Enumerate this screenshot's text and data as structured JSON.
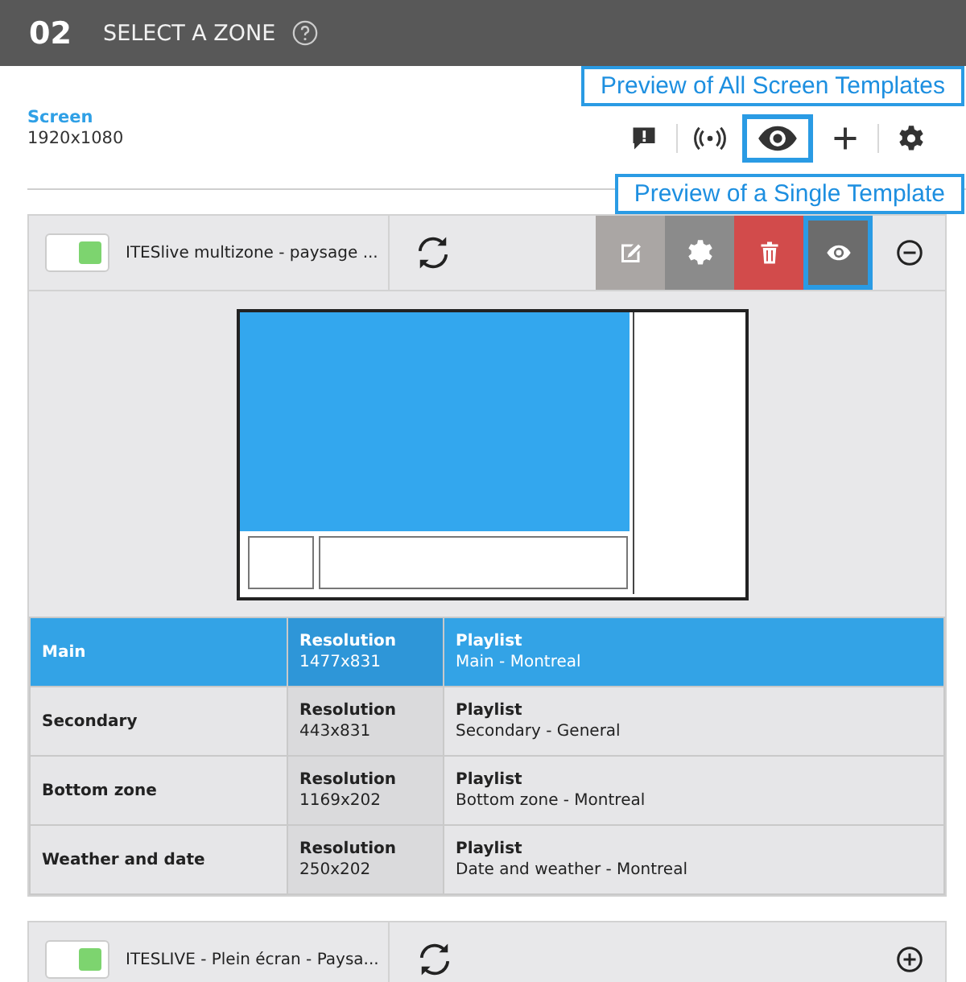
{
  "header": {
    "step": "02",
    "title": "SELECT A ZONE"
  },
  "screen": {
    "label": "Screen",
    "resolution": "1920x1080",
    "toolbar": [
      {
        "kind": "alert",
        "highlighted": false
      },
      {
        "kind": "broadcast",
        "highlighted": false
      },
      {
        "kind": "preview",
        "highlighted": true
      },
      {
        "kind": "add",
        "highlighted": false
      },
      {
        "kind": "settings",
        "highlighted": false
      }
    ]
  },
  "callouts": [
    {
      "text": "Preview of All Screen Templates"
    },
    {
      "text": "Preview of a Single Template"
    }
  ],
  "templates": [
    {
      "name": "ITESlive multizone - paysage ...",
      "enabled": true,
      "expanded": true,
      "actions": [
        {
          "kind": "edit",
          "highlighted": false
        },
        {
          "kind": "settings",
          "highlighted": false
        },
        {
          "kind": "delete",
          "highlighted": false
        },
        {
          "kind": "preview",
          "highlighted": true
        }
      ],
      "zones": [
        {
          "name": "Main",
          "resolution_label": "Resolution",
          "resolution": "1477x831",
          "playlist_label": "Playlist",
          "playlist": "Main - Montreal",
          "selected": true
        },
        {
          "name": "Secondary",
          "resolution_label": "Resolution",
          "resolution": "443x831",
          "playlist_label": "Playlist",
          "playlist": "Secondary - General",
          "selected": false
        },
        {
          "name": "Bottom zone",
          "resolution_label": "Resolution",
          "resolution": "1169x202",
          "playlist_label": "Playlist",
          "playlist": "Bottom zone - Montreal",
          "selected": false
        },
        {
          "name": "Weather and date",
          "resolution_label": "Resolution",
          "resolution": "250x202",
          "playlist_label": "Playlist",
          "playlist": "Date and weather - Montreal",
          "selected": false
        }
      ]
    },
    {
      "name": "ITESLIVE - Plein écran - Paysa...",
      "enabled": true,
      "expanded": false
    }
  ]
}
